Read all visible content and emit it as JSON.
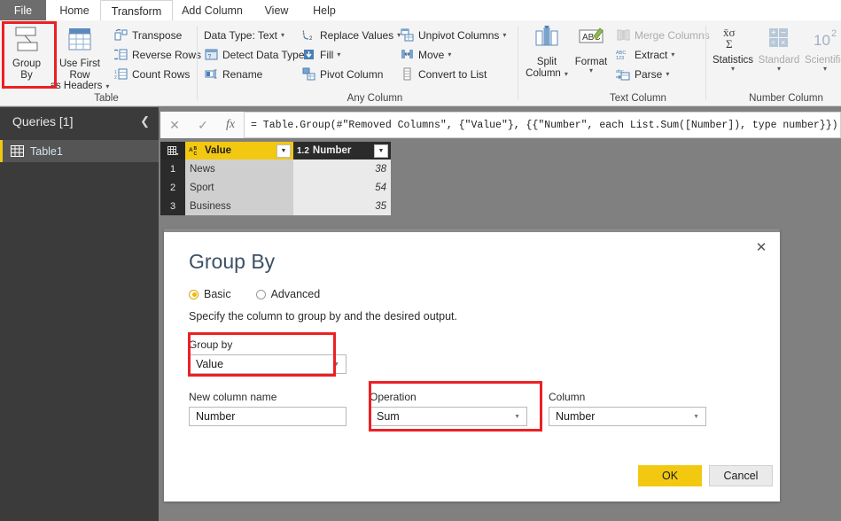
{
  "tabs": [
    {
      "label": "File",
      "active": false,
      "kind": "file"
    },
    {
      "label": "Home",
      "active": false
    },
    {
      "label": "Transform",
      "active": true
    },
    {
      "label": "Add Column",
      "active": false
    },
    {
      "label": "View",
      "active": false
    },
    {
      "label": "Help",
      "active": false
    }
  ],
  "ribbon": {
    "groups": [
      {
        "label": "Table",
        "big": [
          {
            "label_line1": "Group",
            "label_line2": "By",
            "icon": "group-by-icon",
            "disabled": false
          },
          {
            "label_line1": "Use First Row",
            "label_line2": "as Headers",
            "icon": "use-first-row-icon",
            "disabled": false,
            "caret": true
          }
        ],
        "items": [
          {
            "label": "Transpose",
            "icon": "transpose-icon",
            "caret": false,
            "disabled": false
          },
          {
            "label": "Reverse Rows",
            "icon": "reverse-rows-icon",
            "caret": false,
            "disabled": false
          },
          {
            "label": "Count Rows",
            "icon": "count-rows-icon",
            "caret": false,
            "disabled": false
          }
        ]
      },
      {
        "label": "Any Column",
        "items": [
          {
            "label": "Data Type: Text",
            "icon": "none",
            "caret": true,
            "disabled": false
          },
          {
            "label": "Detect Data Type",
            "icon": "detect-data-type-icon",
            "caret": false,
            "disabled": false
          },
          {
            "label": "Rename",
            "icon": "rename-icon",
            "caret": false,
            "disabled": false
          },
          {
            "label": "Replace Values",
            "icon": "replace-values-icon",
            "caret": true,
            "disabled": false
          },
          {
            "label": "Fill",
            "icon": "fill-icon",
            "caret": true,
            "disabled": false
          },
          {
            "label": "Pivot Column",
            "icon": "pivot-column-icon",
            "caret": false,
            "disabled": false
          },
          {
            "label": "Unpivot Columns",
            "icon": "unpivot-columns-icon",
            "caret": true,
            "disabled": false
          },
          {
            "label": "Move",
            "icon": "move-icon",
            "caret": true,
            "disabled": false
          },
          {
            "label": "Convert to List",
            "icon": "convert-to-list-icon",
            "caret": false,
            "disabled": false
          }
        ]
      },
      {
        "label": "Text Column",
        "big": [
          {
            "label_line1": "Split",
            "label_line2": "Column",
            "icon": "split-column-icon",
            "caret": true
          },
          {
            "label_line1": "Format",
            "label_line2": "",
            "icon": "format-icon",
            "caret": true
          }
        ],
        "items": [
          {
            "label": "Merge Columns",
            "icon": "merge-columns-icon",
            "caret": false,
            "disabled": true
          },
          {
            "label": "Extract",
            "icon": "extract-icon",
            "caret": true,
            "disabled": false
          },
          {
            "label": "Parse",
            "icon": "parse-icon",
            "caret": true,
            "disabled": false
          }
        ]
      },
      {
        "label": "Number Column",
        "big": [
          {
            "label_line1": "Statistics",
            "label_line2": "",
            "icon": "statistics-icon",
            "caret": true,
            "disabled": false
          },
          {
            "label_line1": "Standard",
            "label_line2": "",
            "icon": "standard-icon",
            "caret": true,
            "disabled": true
          },
          {
            "label_line1": "Scientific",
            "label_line2": "",
            "icon": "scientific-icon",
            "caret": true,
            "disabled": true
          }
        ]
      }
    ]
  },
  "queries_pane": {
    "title": "Queries [1]",
    "collapse_icon": "chevron-left-icon",
    "items": [
      {
        "label": "Table1",
        "icon": "table-icon",
        "selected": true
      }
    ]
  },
  "formula_bar": {
    "cancel_icon": "cancel-icon",
    "accept_icon": "check-icon",
    "fx_label": "fx",
    "formula": "= Table.Group(#\"Removed Columns\", {\"Value\"}, {{\"Number\", each List.Sum([Number]), type number}})"
  },
  "data_grid": {
    "columns": [
      {
        "name": "Value",
        "type_glyph": "ABC",
        "type": "text"
      },
      {
        "name": "Number",
        "type_glyph": "1.2",
        "type": "number"
      }
    ],
    "rows": [
      {
        "index": "1",
        "Value": "News",
        "Number": "38"
      },
      {
        "index": "2",
        "Value": "Sport",
        "Number": "54"
      },
      {
        "index": "3",
        "Value": "Business",
        "Number": "35"
      }
    ]
  },
  "dialog": {
    "title": "Group By",
    "close_icon": "close-icon",
    "modes": [
      {
        "label": "Basic",
        "selected": true
      },
      {
        "label": "Advanced",
        "selected": false
      }
    ],
    "description": "Specify the column to group by and the desired output.",
    "fields": {
      "group_by": {
        "label": "Group by",
        "value": "Value",
        "control": "dropdown"
      },
      "new_column_name": {
        "label": "New column name",
        "value": "Number",
        "control": "textbox"
      },
      "operation": {
        "label": "Operation",
        "value": "Sum",
        "control": "dropdown"
      },
      "column": {
        "label": "Column",
        "value": "Number",
        "control": "dropdown"
      }
    },
    "buttons": {
      "ok": "OK",
      "cancel": "Cancel"
    }
  },
  "colors": {
    "accent_yellow": "#F2C811",
    "annotation_red": "#EC2024",
    "dark_pane": "#3B3B3B",
    "canvas_gray": "#808080"
  }
}
